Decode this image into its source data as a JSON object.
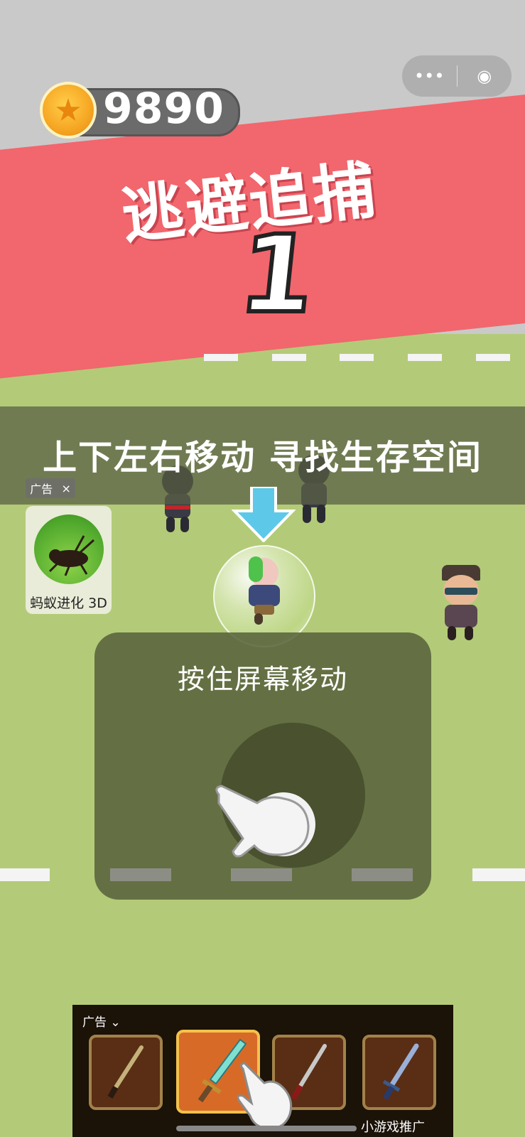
{
  "hud": {
    "coins": "9890",
    "capsule_more": "•••",
    "capsule_close": "◉"
  },
  "banner": {
    "title": "逃避追捕",
    "countdown": "1"
  },
  "instruction": "上下左右移动 寻找生存空间",
  "ad_icon": {
    "tag": "广告",
    "close": "×",
    "name": "蚂蚁进化 3D"
  },
  "touch_panel": {
    "hint": "按住屏幕移动"
  },
  "ad_bar": {
    "tag": "广告 ⌄",
    "promo_label": "小游戏推广",
    "slots": [
      "sword-1",
      "sword-2",
      "sword-3",
      "sword-4"
    ]
  },
  "colors": {
    "banner": "#f2666d",
    "field": "#b3cb78",
    "panel": "#56603a",
    "coin": "#f6a623"
  }
}
